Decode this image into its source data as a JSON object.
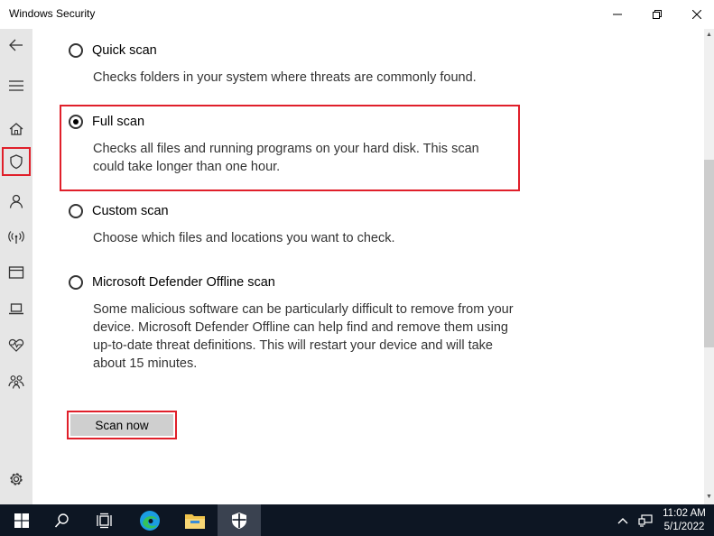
{
  "window": {
    "title": "Windows Security",
    "controls": [
      "minimize-icon",
      "restore-icon",
      "close-icon"
    ]
  },
  "nav": {
    "items": [
      {
        "icon": "back-arrow-icon"
      },
      {
        "icon": "hamburger-menu-icon"
      },
      {
        "icon": "home-icon"
      },
      {
        "icon": "shield-icon",
        "selected": true
      },
      {
        "icon": "person-icon"
      },
      {
        "icon": "wireless-antenna-icon"
      },
      {
        "icon": "app-browser-icon"
      },
      {
        "icon": "laptop-icon"
      },
      {
        "icon": "heart-pulse-icon"
      },
      {
        "icon": "family-icon"
      },
      {
        "icon": "gear-icon"
      }
    ]
  },
  "scan_options": [
    {
      "label": "Quick scan",
      "description": "Checks folders in your system where threats are commonly found.",
      "selected": false
    },
    {
      "label": "Full scan",
      "description": "Checks all files and running programs on your hard disk. This scan could take longer than one hour.",
      "selected": true
    },
    {
      "label": "Custom scan",
      "description": "Choose which files and locations you want to check.",
      "selected": false
    },
    {
      "label": "Microsoft Defender Offline scan",
      "description": "Some malicious software can be particularly difficult to remove from your device. Microsoft Defender Offline can help find and remove them using up-to-date threat definitions. This will restart your device and will take about 15 minutes.",
      "selected": false
    }
  ],
  "actions": {
    "scan_now_label": "Scan now"
  },
  "taskbar": {
    "items": [
      "windows-start-icon",
      "search-icon",
      "task-view-icon",
      "edge-browser-icon",
      "file-explorer-icon",
      "windows-security-icon"
    ],
    "time": "11:02 AM",
    "date": "5/1/2022"
  },
  "colors": {
    "highlight": "#e01f2a",
    "nav_bg": "#e6e6e6",
    "taskbar_bg": "#0d1623",
    "button_bg": "#cfcfcf"
  }
}
